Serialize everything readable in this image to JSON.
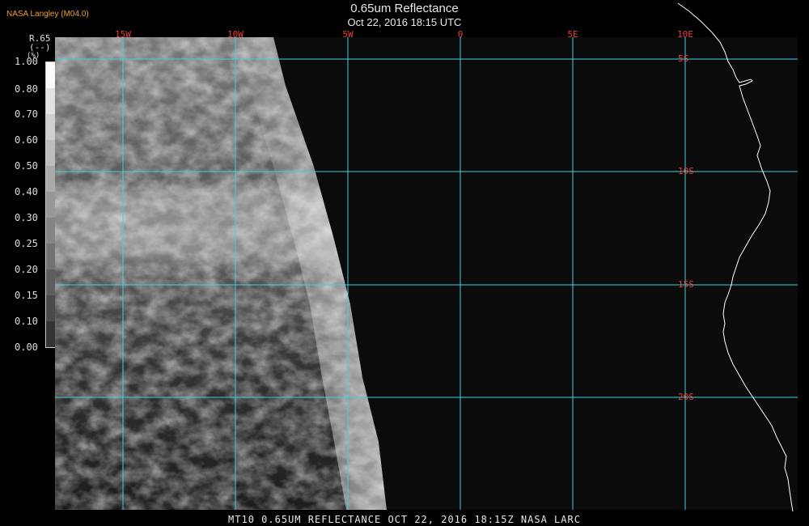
{
  "header": {
    "credit": "NASA Langley (M04.0)",
    "title": "0.65um Reflectance",
    "subtitle": "Oct 22, 2016 18:15 UTC"
  },
  "footer": {
    "caption": "MT10  0.65UM REFLECTANCE   OCT 22, 2016 18:15Z   NASA LARC"
  },
  "colorbar": {
    "label_line1": "R.65",
    "label_line2": "(--)",
    "label_line3": "(%)",
    "ticks": [
      "1.00",
      "0.80",
      "0.70",
      "0.60",
      "0.50",
      "0.40",
      "0.30",
      "0.25",
      "0.20",
      "0.15",
      "0.10",
      "0.00"
    ]
  },
  "map": {
    "longitude_labels": [
      "15W",
      "10W",
      "5W",
      "0",
      "5E",
      "10E"
    ],
    "latitude_labels": [
      "5S",
      "10S",
      "15S",
      "20S"
    ],
    "grid_color": "#40d0e0",
    "label_color": "#e84040",
    "coastline_color": "#ffffff"
  }
}
